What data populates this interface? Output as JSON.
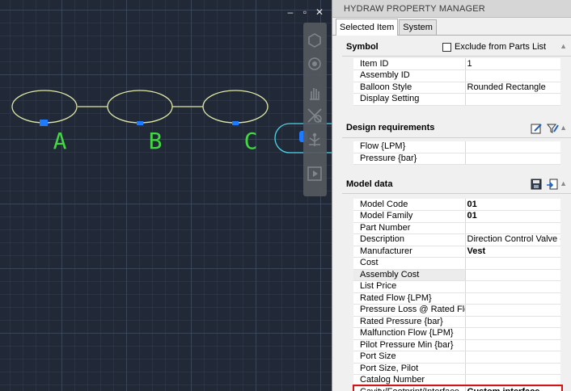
{
  "viewport": {
    "controls": [
      "–",
      "▫",
      "✕"
    ],
    "balloon_labels": [
      "A",
      "B",
      "C"
    ],
    "colors": {
      "grid_bg": "#212836",
      "balloon_stroke": "#e0e8a8",
      "label_green": "#43d843",
      "grip_blue": "#1e7bff",
      "selection_cyan": "#4fd4e8"
    }
  },
  "nav_bar": {
    "icons": [
      "steering-wheel-icon",
      "orbit-icon",
      "pan-icon",
      "zoom-icon",
      "orbit-3d-icon",
      "showmotion-icon"
    ]
  },
  "palette": {
    "title": "HYDRAW PROPERTY MANAGER",
    "tabs": [
      {
        "label": "Selected Item",
        "active": true
      },
      {
        "label": "System",
        "active": false
      }
    ],
    "symbol": {
      "header": "Symbol",
      "exclude_label": "Exclude from Parts List",
      "exclude_checked": false,
      "rows": [
        {
          "label": "Item ID",
          "value": "1"
        },
        {
          "label": "Assembly ID",
          "value": ""
        },
        {
          "label": "Balloon Style",
          "value": "Rounded Rectangle"
        },
        {
          "label": "Display Setting",
          "value": "",
          "expander": "›"
        }
      ]
    },
    "design": {
      "header": "Design requirements",
      "rows": [
        {
          "label": "Flow {LPM}",
          "value": ""
        },
        {
          "label": "Pressure {bar}",
          "value": ""
        }
      ]
    },
    "model": {
      "header": "Model data",
      "rows": [
        {
          "label": "Model Code",
          "value": "01",
          "bold": true
        },
        {
          "label": "Model Family",
          "value": "01",
          "bold": true
        },
        {
          "label": "Part Number",
          "value": ""
        },
        {
          "label": "Description",
          "value": "Direction Control Valve - A"
        },
        {
          "label": "Manufacturer",
          "value": "Vest",
          "bold": true
        },
        {
          "label": "Cost",
          "value": ""
        },
        {
          "label": "Assembly Cost",
          "value": "",
          "shaded": true
        },
        {
          "label": "List Price",
          "value": ""
        },
        {
          "label": "Rated Flow {LPM}",
          "value": ""
        },
        {
          "label": "Pressure Loss @ Rated Flow",
          "value": ""
        },
        {
          "label": "Rated Pressure {bar}",
          "value": ""
        },
        {
          "label": "Malfunction Flow {LPM}",
          "value": ""
        },
        {
          "label": "Pilot Pressure Min {bar}",
          "value": ""
        },
        {
          "label": "Port Size",
          "value": ""
        },
        {
          "label": "Port Size, Pilot",
          "value": ""
        },
        {
          "label": "Catalog Number",
          "value": ""
        },
        {
          "label": "Cavity/Footprint/Interface",
          "value": "Custom interface",
          "bold": true,
          "highlighted": true
        }
      ]
    },
    "highlight_color": "#d11616"
  }
}
